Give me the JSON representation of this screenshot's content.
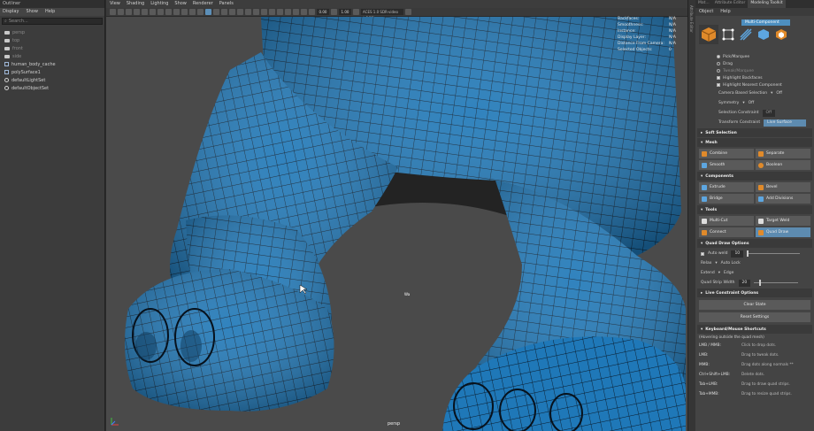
{
  "outliner": {
    "title": "Outliner",
    "menu": [
      "Display",
      "Show",
      "Help"
    ],
    "search_placeholder": "Search...",
    "items": [
      {
        "label": "persp",
        "icon": "camera-icon",
        "dim": true
      },
      {
        "label": "top",
        "icon": "camera-icon",
        "dim": true
      },
      {
        "label": "front",
        "icon": "camera-icon",
        "dim": true
      },
      {
        "label": "side",
        "icon": "camera-icon",
        "dim": true
      },
      {
        "label": "human_body_cache",
        "icon": "object-icon",
        "dim": false
      },
      {
        "label": "polySurface1",
        "icon": "object-icon",
        "dim": false
      },
      {
        "label": "defaultLightSet",
        "icon": "set-icon",
        "dim": false
      },
      {
        "label": "defaultObjectSet",
        "icon": "set-icon",
        "dim": false
      }
    ]
  },
  "viewport": {
    "menu": [
      "View",
      "Shading",
      "Lighting",
      "Show",
      "Renderer",
      "Panels"
    ],
    "field_a": "0.00",
    "field_b": "1.00",
    "colorspace": "ACES 1.0 SDR-video (sRGB)",
    "camera_label": "persp",
    "cursor_label": "Wa",
    "hud": [
      {
        "k": "Backfaces:",
        "v": "N/A"
      },
      {
        "k": "Smoothness:",
        "v": "N/A"
      },
      {
        "k": "Instance:",
        "v": "N/A"
      },
      {
        "k": "Display Layer:",
        "v": "N/A"
      },
      {
        "k": "Distance From Camera:",
        "v": "N/A"
      },
      {
        "k": "Selected Objects:",
        "v": "0"
      }
    ],
    "mesh_color": "#1f78b8",
    "bg_color": "#4a4a4a"
  },
  "strip_label": "Attribute Editor",
  "toolkit": {
    "tabs": [
      "Mat...",
      "Attribute Editor",
      "Modeling Toolkit"
    ],
    "active_tab": 2,
    "menu": [
      "Object",
      "Help"
    ],
    "mode_title": "Multi-Component",
    "pick": [
      {
        "label": "Pick/Marquee",
        "on": true
      },
      {
        "label": "Drag",
        "on": false
      },
      {
        "label": "Tweak/Marquee",
        "on": false
      }
    ],
    "checks": [
      "Highlight Backfaces",
      "Highlight Nearest Component"
    ],
    "camera_sel": {
      "label": "Camera Based Selection",
      "value": "Off"
    },
    "symmetry": {
      "label": "Symmetry",
      "value": "Off"
    },
    "sel_constraint": {
      "label": "Selection Constraint",
      "value": "Off"
    },
    "transform_constraint": {
      "label": "Transform Constraint",
      "value": "Live Surface"
    },
    "sections": {
      "soft": "Soft Selection",
      "mesh": "Mesh",
      "components": "Components",
      "tools": "Tools",
      "quad": "Quad Draw Options",
      "live": "Live Constraint Options",
      "keys": "Keyboard/Mouse Shortcuts"
    },
    "mesh_buttons": [
      "Combine",
      "Separate",
      "Smooth",
      "Boolean"
    ],
    "component_buttons": [
      "Extrude",
      "Bevel",
      "Bridge",
      "Add Divisions"
    ],
    "tool_buttons": [
      "Multi-Cut",
      "Target Weld",
      "Connect",
      "Quad Draw"
    ],
    "quad": {
      "auto_weld_label": "Auto weld",
      "auto_weld_value": "10",
      "relax_label": "Relax",
      "relax_value": "Auto Lock",
      "extend_label": "Extend",
      "extend_value": "Edge",
      "strip_label": "Quad Strip Width",
      "strip_value": "20"
    },
    "clear_state": "Clear State",
    "reset_settings": "Reset Settings",
    "shortcut_note": "(Hovering outside the quad mesh)",
    "shortcuts": [
      {
        "k": "LMB / MMB:",
        "v": "Click to drop dots."
      },
      {
        "k": "LMB:",
        "v": "Drag to tweak dots."
      },
      {
        "k": "MMB:",
        "v": "Drag dots along normals **"
      },
      {
        "k": "Ctrl+Shift+LMB:",
        "v": "Delete dots."
      },
      {
        "k": "Tab+LMB:",
        "v": "Drag to draw quad strips."
      },
      {
        "k": "Tab+MMB:",
        "v": "Drag to resize quad strips."
      }
    ]
  }
}
